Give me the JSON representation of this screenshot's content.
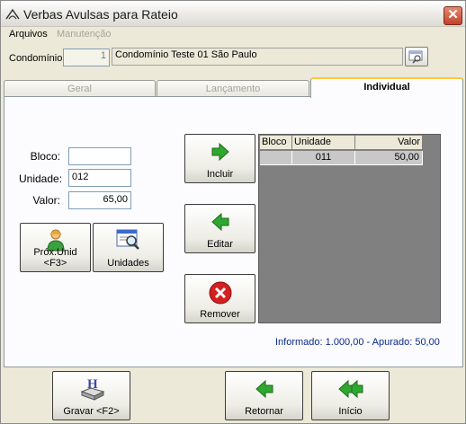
{
  "window": {
    "title": "Verbas Avulsas para Rateio",
    "close_label": "✕"
  },
  "menu": {
    "arquivos": "Arquivos",
    "manutencao": "Manutenção"
  },
  "condominio": {
    "label": "Condomínio:",
    "code": "1",
    "name": "Condomínio Teste 01 São Paulo"
  },
  "tabs": [
    {
      "label": "Geral",
      "active": false
    },
    {
      "label": "Lançamento",
      "active": false
    },
    {
      "label": "Individual",
      "active": true
    }
  ],
  "form": {
    "bloco_label": "Bloco:",
    "bloco_value": "",
    "unidade_label": "Unidade:",
    "unidade_value": "012",
    "valor_label": "Valor:",
    "valor_value": "65,00"
  },
  "buttons": {
    "prox_unid": "Próx.Unid <F3>",
    "unidades": "Unidades",
    "incluir": "Incluir",
    "editar": "Editar",
    "remover": "Remover",
    "gravar": "Gravar <F2>",
    "retornar": "Retornar",
    "inicio": "Início"
  },
  "grid": {
    "columns": [
      "Bloco",
      "Unidade",
      "Valor"
    ],
    "rows": [
      {
        "bloco": "",
        "unidade": "011",
        "valor": "50,00"
      }
    ]
  },
  "summary": "Informado: 1.000,00 - Apurado: 50,00",
  "colors": {
    "accent_tab": "#ffc83c",
    "arrow_green": "#2fa82f",
    "remove_red": "#d42020",
    "summary_text": "#0a2a8a"
  }
}
